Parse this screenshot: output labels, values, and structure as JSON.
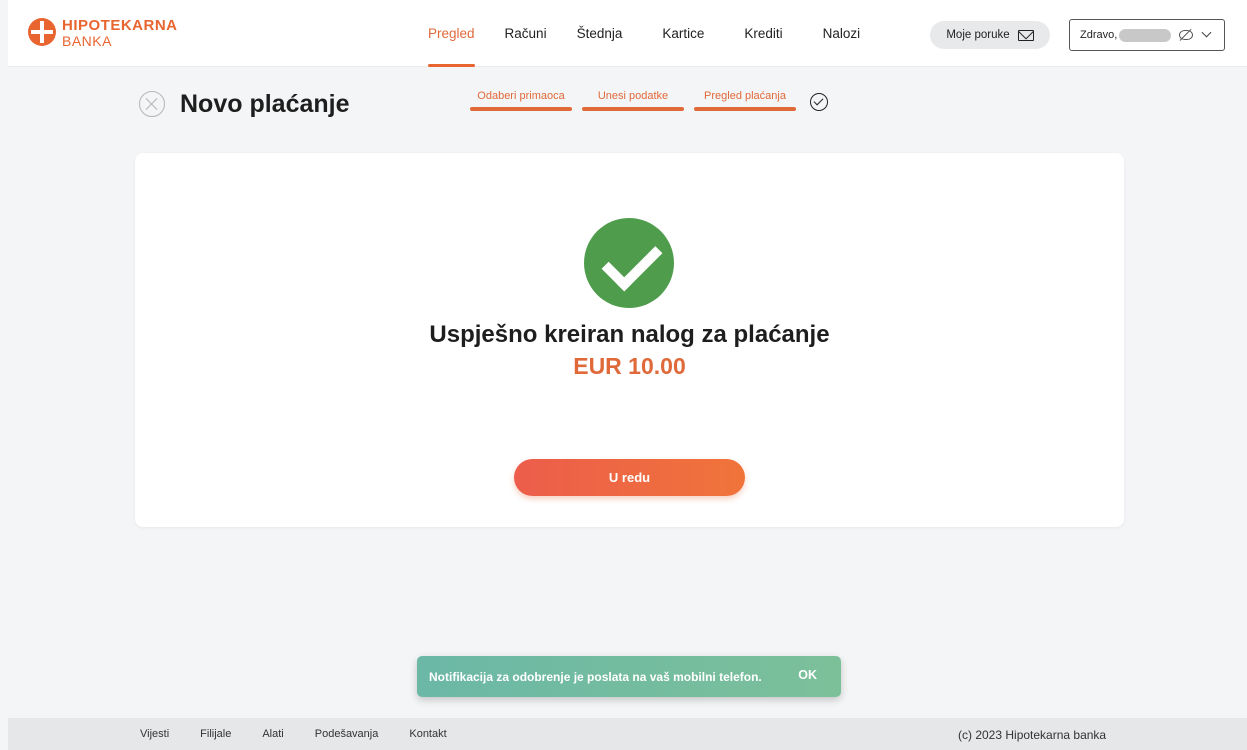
{
  "header": {
    "logo": {
      "line1": "HIPOTEKARNA",
      "line2": "BANKA"
    },
    "nav": [
      {
        "label": "Pregled",
        "active": true
      },
      {
        "label": "Računi",
        "active": false
      },
      {
        "label": "Štednja",
        "active": false
      },
      {
        "label": "Kartice",
        "active": false
      },
      {
        "label": "Krediti",
        "active": false
      },
      {
        "label": "Nalozi",
        "active": false
      }
    ],
    "messages_label": "Moje poruke",
    "greeting": "Zdravo,"
  },
  "page": {
    "title": "Novo plaćanje",
    "steps": [
      "Odaberi primaoca",
      "Unesi podatke",
      "Pregled plaćanja"
    ]
  },
  "result": {
    "title": "Uspješno kreiran nalog za plaćanje",
    "amount": "EUR 10.00",
    "ok_label": "U redu"
  },
  "toast": {
    "message": "Notifikacija za odobrenje je poslata na vaš mobilni telefon.",
    "ok_label": "OK"
  },
  "footer": {
    "links": [
      "Vijesti",
      "Filijale",
      "Alati",
      "Podešavanja",
      "Kontakt"
    ],
    "copyright": "(c) 2023 Hipotekarna banka"
  },
  "colors": {
    "brand": "#e8652f",
    "success": "#4f9d4c",
    "toast": "#6bb8a6"
  }
}
